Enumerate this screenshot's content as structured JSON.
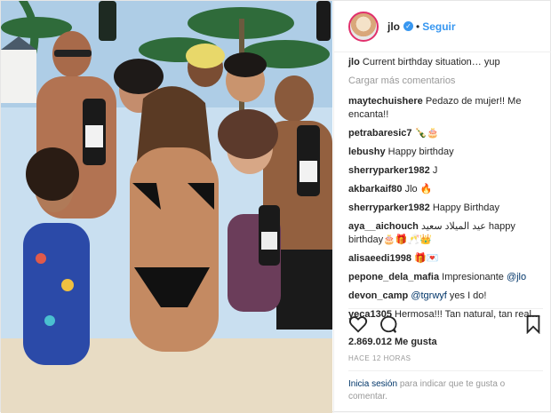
{
  "post": {
    "username": "jlo",
    "follow_label": "Seguir",
    "caption_user": "jlo",
    "caption_text": "Current birthday situation… yup",
    "load_more": "Cargar más comentarios",
    "comments": [
      {
        "user": "maytechuishere",
        "text": "Pedazo de mujer!! Me encanta!!"
      },
      {
        "user": "petrabaresic7",
        "text": "🍾🎂"
      },
      {
        "user": "lebushy",
        "text": "Happy birthday"
      },
      {
        "user": "sherryparker1982",
        "text": "J"
      },
      {
        "user": "akbarkaif80",
        "text": "Jlo 🔥"
      },
      {
        "user": "sherryparker1982",
        "text": "Happy Birthday"
      },
      {
        "user": "aya__aichouch",
        "text": "عيد الميلاد سعيد happy birthday🎂🎁🥂👑"
      },
      {
        "user": "alisaeedi1998",
        "text": "🎁💌"
      },
      {
        "user": "pepone_dela_mafia",
        "text": "Impresionante",
        "mention": "@jlo"
      },
      {
        "user": "devon_camp",
        "mention": "@tgrwyf",
        "text": "yes I do!"
      },
      {
        "user": "yeca1305",
        "text": "Hermosa!!! Tan natural, tan real…"
      }
    ],
    "likes": "2.869.012 Me gusta",
    "time": "HACE 12 HORAS",
    "login_link": "Inicia sesión",
    "login_text": "para indicar que te gusta o comentar."
  },
  "icons": {
    "like": "heart-icon",
    "comment": "comment-icon",
    "save": "bookmark-icon",
    "verified": "verified-badge-icon"
  },
  "colors": {
    "link_blue": "#3897f0",
    "text": "#262626",
    "muted": "#999999"
  }
}
